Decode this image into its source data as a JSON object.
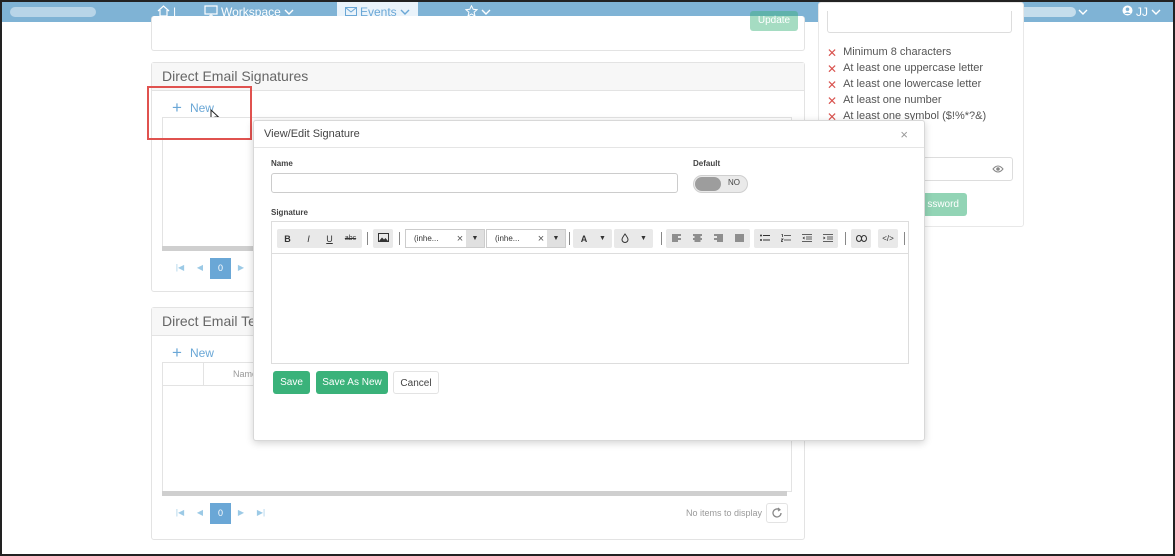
{
  "nav": {
    "workspace_label": "Workspace",
    "events_label": "Events",
    "user_label": "JJ",
    "separator": "|"
  },
  "background": {
    "signatures_panel_title": "Direct Email Signatures",
    "templates_panel_title": "Direct Email Te",
    "new_label": "New",
    "column_name": "Name",
    "page_number": "0",
    "no_items_text": "No items to display",
    "update_button": "Update",
    "password_button": "ssword"
  },
  "password_rules": [
    "Minimum 8 characters",
    "At least one uppercase letter",
    "At least one lowercase letter",
    "At least one number",
    "At least one symbol ($!%*?&)"
  ],
  "modal": {
    "title": "View/Edit Signature",
    "close_glyph": "×",
    "name_label": "Name",
    "name_value": "",
    "default_label": "Default",
    "default_toggle_text": "NO",
    "signature_label": "Signature",
    "font_family_value": "(inhe...",
    "font_size_value": "(inhe...",
    "save_label": "Save",
    "save_as_new_label": "Save As New",
    "cancel_label": "Cancel"
  },
  "colors": {
    "nav": "#7fb3d5",
    "accent": "#6aa7d6",
    "success": "#3ab27a",
    "error": "#d9534f",
    "highlight": "#e0524f"
  }
}
